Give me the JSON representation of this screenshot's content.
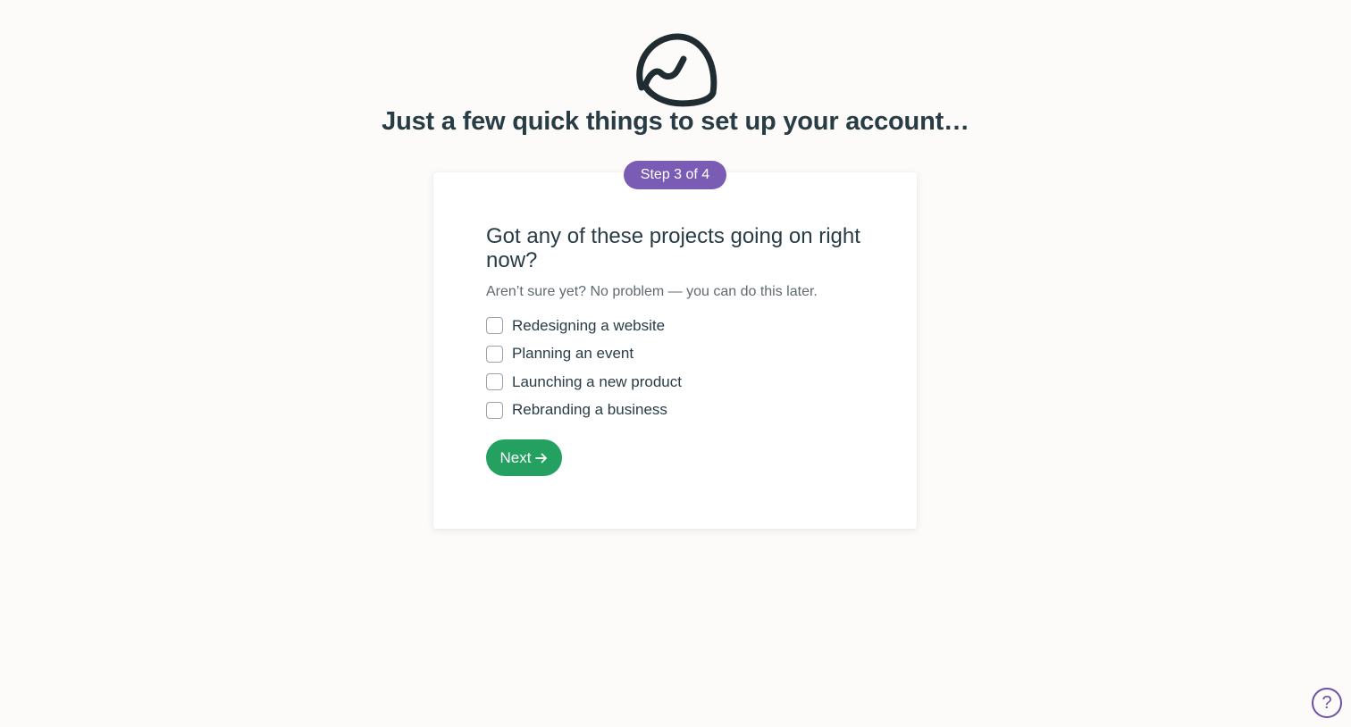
{
  "header": {
    "headline": "Just a few quick things to set up your account…"
  },
  "step": {
    "label": "Step 3 of 4",
    "current": 3,
    "total": 4
  },
  "form": {
    "question": "Got any of these projects going on right now?",
    "subtitle": "Aren’t sure yet? No problem — you can do this later.",
    "options": [
      {
        "label": "Redesigning a website",
        "checked": false
      },
      {
        "label": "Planning an event",
        "checked": false
      },
      {
        "label": "Launching a new product",
        "checked": false
      },
      {
        "label": "Rebranding a business",
        "checked": false
      }
    ],
    "next_label": "Next",
    "next_icon": "arrow-right-icon"
  },
  "help": {
    "icon": "question-mark-icon",
    "glyph": "?"
  },
  "colors": {
    "background": "#fcfbf9",
    "text": "#283c46",
    "step_badge": "#7a5cb5",
    "next_button": "#24a061",
    "help_icon": "#6b4fa8"
  }
}
